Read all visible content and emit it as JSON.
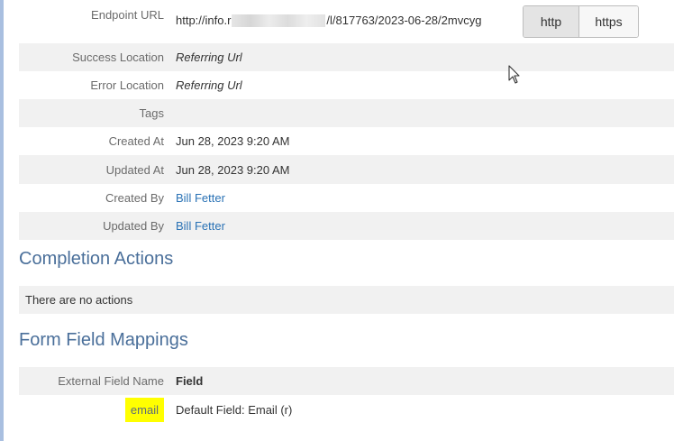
{
  "details": {
    "endpoint": {
      "label": "Endpoint URL",
      "url_prefix": "http://info.r",
      "url_suffix": "/l/817763/2023-06-28/2mvcyg",
      "protocol_buttons": [
        "http",
        "https"
      ],
      "selected_protocol": "http"
    },
    "rows": [
      {
        "label": "Success Location",
        "value": "Referring Url"
      },
      {
        "label": "Error Location",
        "value": "Referring Url"
      },
      {
        "label": "Tags",
        "value": ""
      },
      {
        "label": "Created At",
        "value": "Jun 28, 2023 9:20 AM"
      },
      {
        "label": "Updated At",
        "value": "Jun 28, 2023 9:20 AM"
      },
      {
        "label": "Created By",
        "value": "Bill Fetter"
      },
      {
        "label": "Updated By",
        "value": "Bill Fetter"
      }
    ]
  },
  "completion_actions": {
    "title": "Completion Actions",
    "empty_message": "There are no actions"
  },
  "form_field_mappings": {
    "title": "Form Field Mappings",
    "header": {
      "external_field_name": "External Field Name",
      "field": "Field"
    },
    "rows": [
      {
        "external_field_name": "email",
        "field": "Default Field: Email (r)"
      }
    ]
  },
  "colors": {
    "link": "#2a72b5",
    "section_title": "#4a6f9a",
    "row_shade": "#f1f1f1",
    "highlight": "#ffff00"
  },
  "icons": {
    "cursor": "mouse-pointer-icon"
  }
}
